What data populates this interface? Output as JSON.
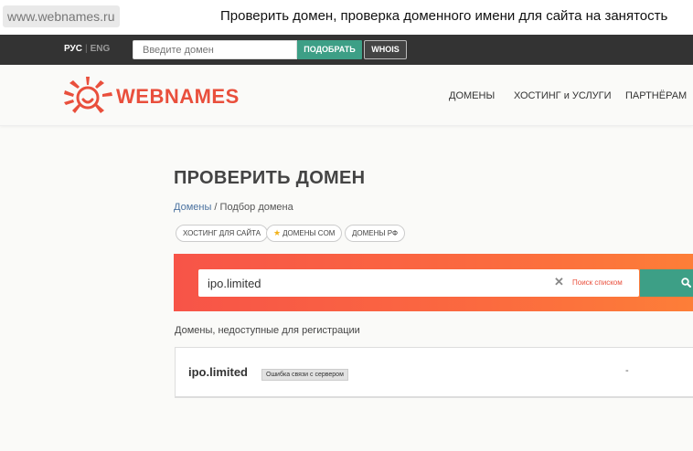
{
  "browser": {
    "url": "www.webnames.ru",
    "title": "Проверить домен, проверка доменного имени для сайта на занятость"
  },
  "topbar": {
    "lang_active": "РУС",
    "lang_sep": "|",
    "lang_other": "ENG",
    "input_placeholder": "Введите домен",
    "pick_button": "ПОДОБРАТЬ",
    "whois_button": "WHOIS"
  },
  "header": {
    "logo_text": "WEBNAMES",
    "nav": [
      "ДОМЕНЫ",
      "ХОСТИНГ и УСЛУГИ",
      "ПАРТНЁРАМ"
    ]
  },
  "main": {
    "title": "ПРОВЕРИТЬ ДОМЕН",
    "breadcrumb": {
      "link": "Домены",
      "sep": " / ",
      "current": "Подбор домена"
    },
    "chips": [
      "ХОСТИНГ ДЛЯ САЙТА",
      "ДОМЕНЫ COM",
      "ДОМЕНЫ РФ"
    ],
    "search": {
      "value": "ipo.limited",
      "clear": "✕",
      "list_search": "Поиск списком"
    },
    "unavailable_label": "Домены, недоступные для регистрации",
    "result": {
      "domain": "ipo.limited",
      "badge": "Ошибка связи с сервером",
      "dash": "-"
    }
  },
  "colors": {
    "accent_red": "#e94f3c",
    "accent_green": "#3d9f86",
    "topbar_bg": "#333333"
  },
  "icons": {
    "logo": "sun-logo-icon",
    "star": "star-icon",
    "search": "search-icon",
    "clear": "close-icon"
  }
}
